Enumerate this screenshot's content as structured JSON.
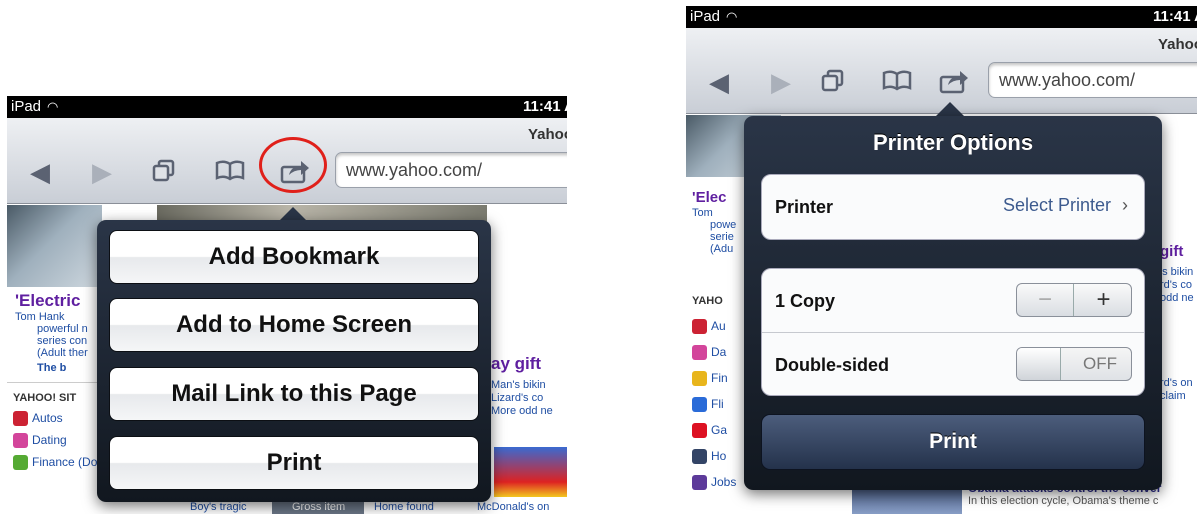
{
  "left": {
    "status": {
      "carrier": "iPad",
      "time": "11:41 A"
    },
    "toolbar": {
      "page_title": "Yahoo",
      "url": "www.yahoo.com/"
    },
    "content": {
      "headline": "'Electric",
      "story_lines": [
        "Tom Hank",
        "powerful n",
        "series con",
        "(Adult ther",
        "The b"
      ],
      "sites_title": "YAHOO! SIT",
      "sites": [
        "Autos",
        "Dating",
        "Finance (Dow"
      ],
      "right_headline": "ay gift",
      "right_lines": [
        "Man's bikin",
        "Lizard's co",
        "More odd ne"
      ],
      "bottom_captions": [
        "Boy's tragic",
        "Gross item",
        "Home found",
        "McDonald's on"
      ]
    },
    "menu": [
      "Add Bookmark",
      "Add to Home Screen",
      "Mail Link to this Page",
      "Print"
    ]
  },
  "right": {
    "status": {
      "carrier": "iPad",
      "time": "11:41 A"
    },
    "toolbar": {
      "page_title": "Yahoo",
      "url": "www.yahoo.com/"
    },
    "content": {
      "headline": "'Elec",
      "story_lines": [
        "Tom",
        "powe",
        "serie",
        "(Adu"
      ],
      "sites_title": "YAHO",
      "sites": [
        "Au",
        "Da",
        "Fin",
        "Fli",
        "Ga",
        "Ho",
        "Jobs"
      ],
      "right_headline": "gift",
      "right_lines": [
        "'s bikin",
        "rd's co",
        "odd ne",
        "rd's on",
        "claim"
      ],
      "news_title": "Obama attacks control the conver",
      "news_sub": "In this election cycle, Obama's theme c"
    },
    "printer_options": {
      "title": "Printer Options",
      "printer_label": "Printer",
      "printer_value": "Select Printer",
      "copies_label": "1 Copy",
      "stepper_minus": "−",
      "stepper_plus": "+",
      "duplex_label": "Double-sided",
      "duplex_value": "OFF",
      "print_button": "Print"
    }
  },
  "colors": {
    "accent_red": "#e0201a",
    "popover_dark": "#1c2431",
    "print_button": "#34435f"
  },
  "icons": [
    "back-icon",
    "forward-icon",
    "tabs-icon",
    "bookmarks-icon",
    "share-icon",
    "wifi-icon",
    "chevron-right-icon"
  ]
}
